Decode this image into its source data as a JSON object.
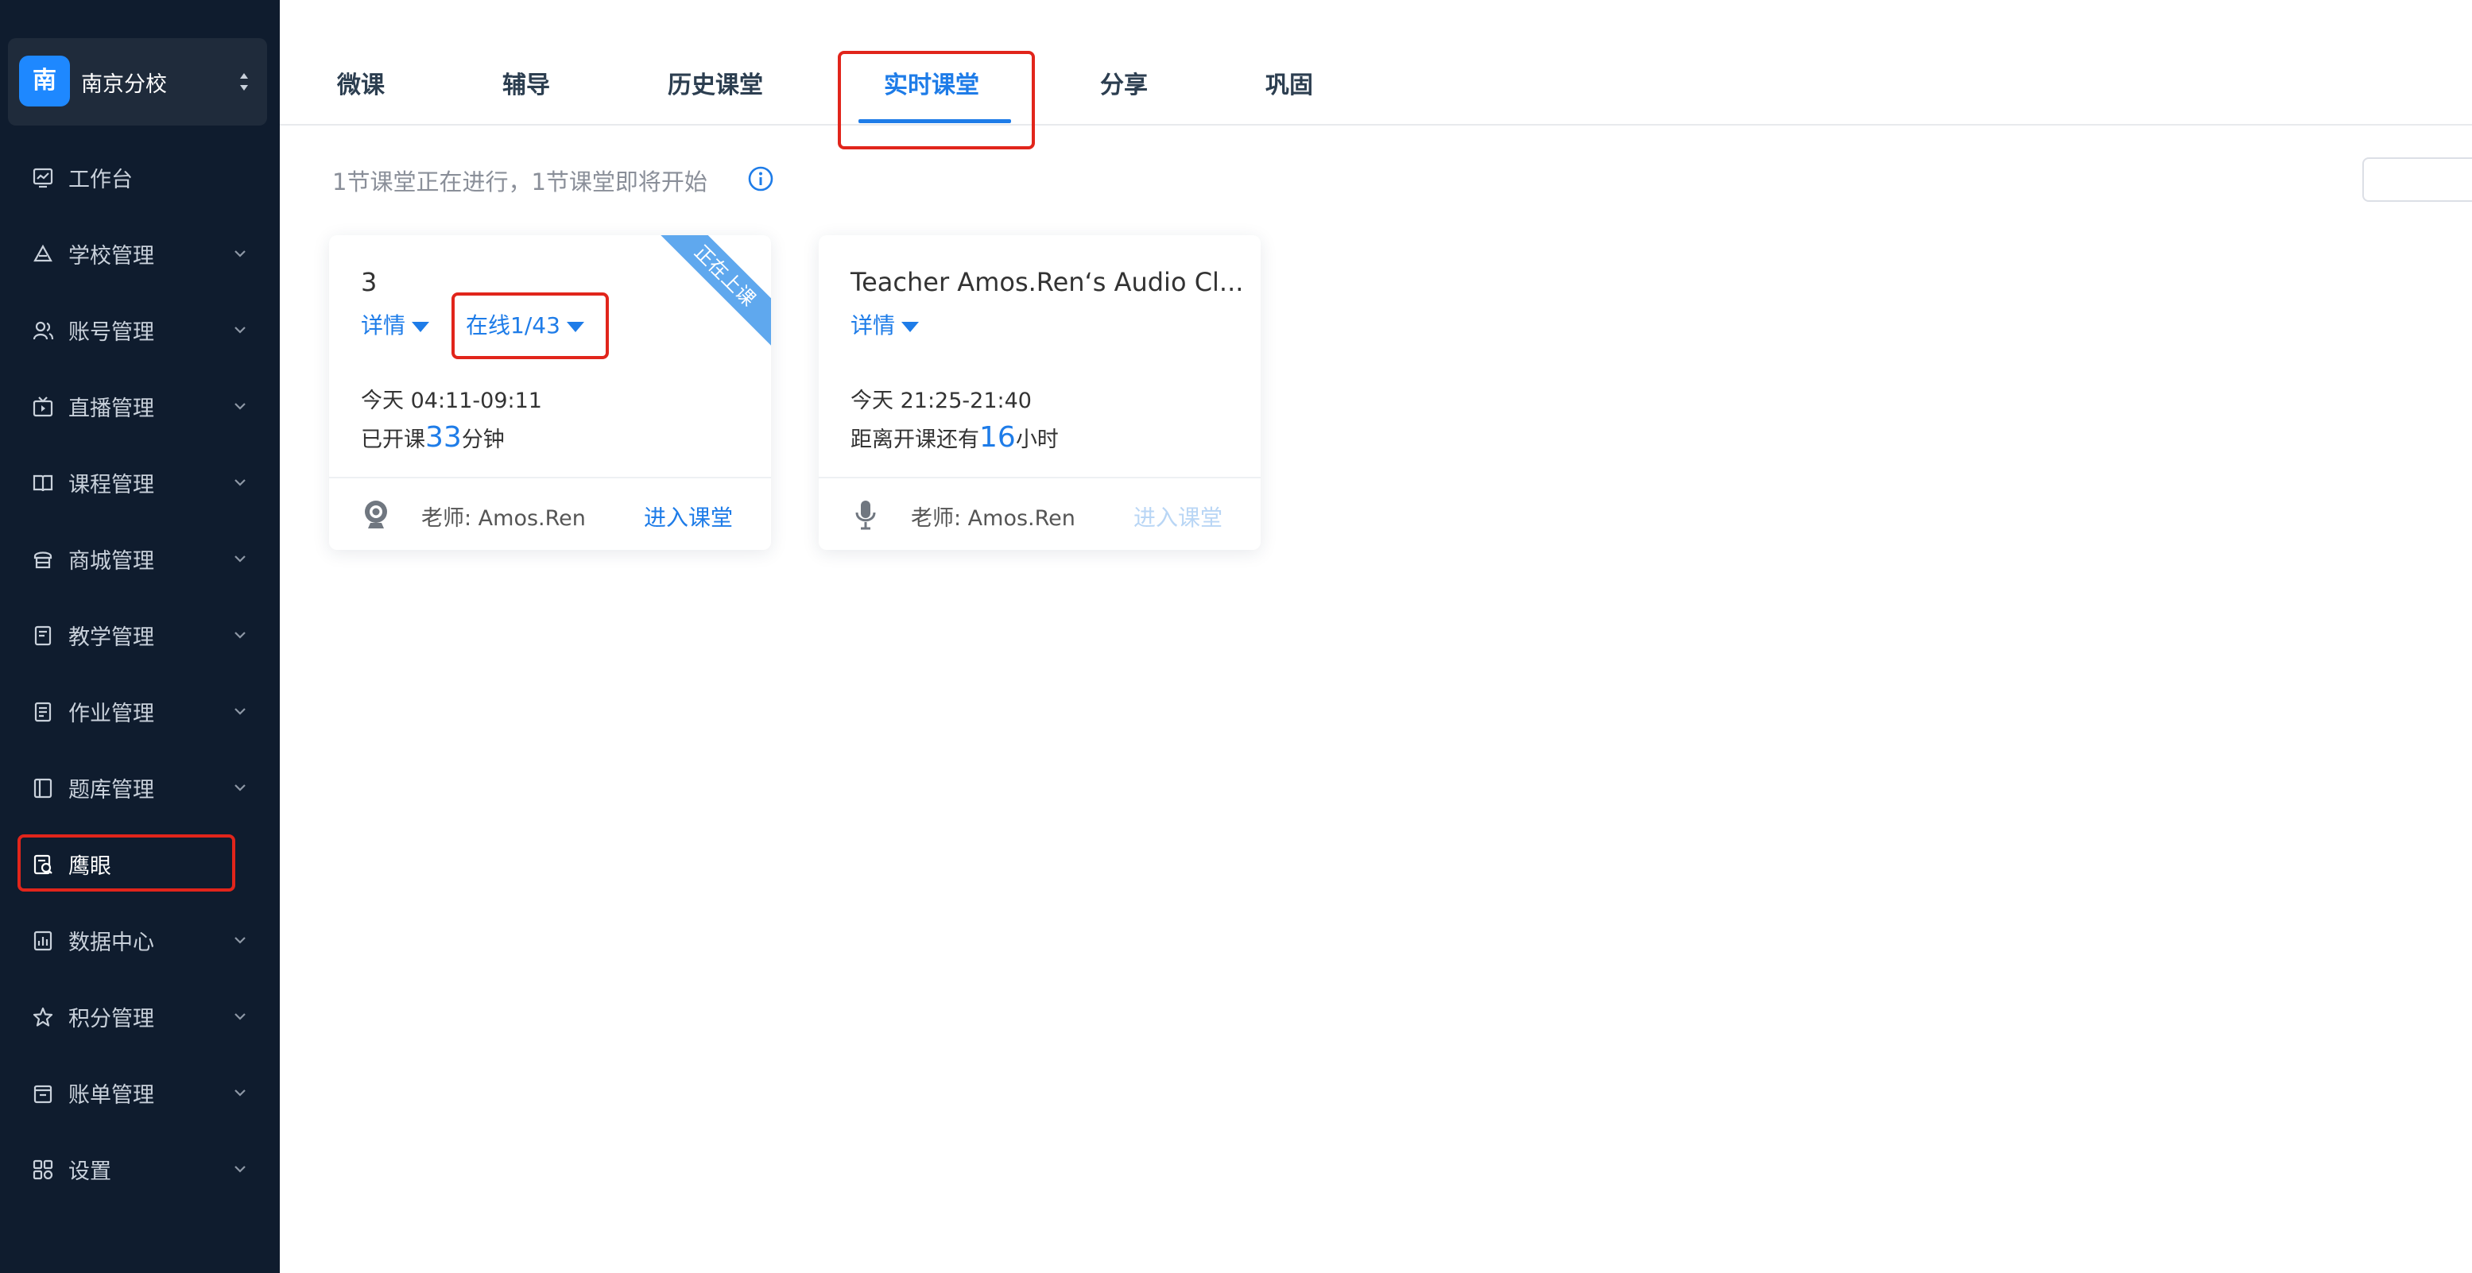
{
  "sidebar": {
    "school": {
      "logo_char": "南",
      "name": "南京分校"
    },
    "items": [
      {
        "label": "工作台",
        "icon": "dashboard-icon",
        "has_children": false
      },
      {
        "label": "学校管理",
        "icon": "school-icon",
        "has_children": true
      },
      {
        "label": "账号管理",
        "icon": "users-icon",
        "has_children": true
      },
      {
        "label": "直播管理",
        "icon": "live-tv-icon",
        "has_children": true
      },
      {
        "label": "课程管理",
        "icon": "book-open-icon",
        "has_children": true
      },
      {
        "label": "商城管理",
        "icon": "store-icon",
        "has_children": true
      },
      {
        "label": "教学管理",
        "icon": "teaching-icon",
        "has_children": true
      },
      {
        "label": "作业管理",
        "icon": "homework-icon",
        "has_children": true
      },
      {
        "label": "题库管理",
        "icon": "question-bank-icon",
        "has_children": true
      },
      {
        "label": "鹰眼",
        "icon": "eagle-eye-icon",
        "has_children": false,
        "active": true
      },
      {
        "label": "数据中心",
        "icon": "chart-icon",
        "has_children": true
      },
      {
        "label": "积分管理",
        "icon": "star-icon",
        "has_children": true
      },
      {
        "label": "账单管理",
        "icon": "bill-icon",
        "has_children": true
      },
      {
        "label": "设置",
        "icon": "grid-settings-icon",
        "has_children": true
      }
    ]
  },
  "tabs": [
    {
      "label": "微课"
    },
    {
      "label": "辅导"
    },
    {
      "label": "历史课堂"
    },
    {
      "label": "实时课堂",
      "active": true
    },
    {
      "label": "分享"
    },
    {
      "label": "巩固"
    }
  ],
  "status_text": "1节课堂正在进行，1节课堂即将开始",
  "cards": [
    {
      "title": "3",
      "detail_label": "详情",
      "online_label": "在线1/43",
      "ribbon": "正在上课",
      "time": "今天 04:11-09:11",
      "duration_prefix": "已开课",
      "duration_num": "33",
      "duration_suffix": "分钟",
      "teacher": "老师: Amos.Ren",
      "enter_label": "进入课堂",
      "footer_icon": "webcam-icon"
    },
    {
      "title": "Teacher Amos.Ren‘s Audio Cl...",
      "detail_label": "详情",
      "time": "今天 21:25-21:40",
      "duration_prefix": "距离开课还有",
      "duration_num": "16",
      "duration_suffix": "小时",
      "teacher": "老师: Amos.Ren",
      "enter_label": "进入课堂",
      "enter_disabled": true,
      "footer_icon": "microphone-icon"
    }
  ],
  "colors": {
    "accent": "#1e7ce8",
    "sidebar_bg": "#0f1c2e",
    "highlight": "#e1251b",
    "ribbon": "#5fa8ee"
  }
}
